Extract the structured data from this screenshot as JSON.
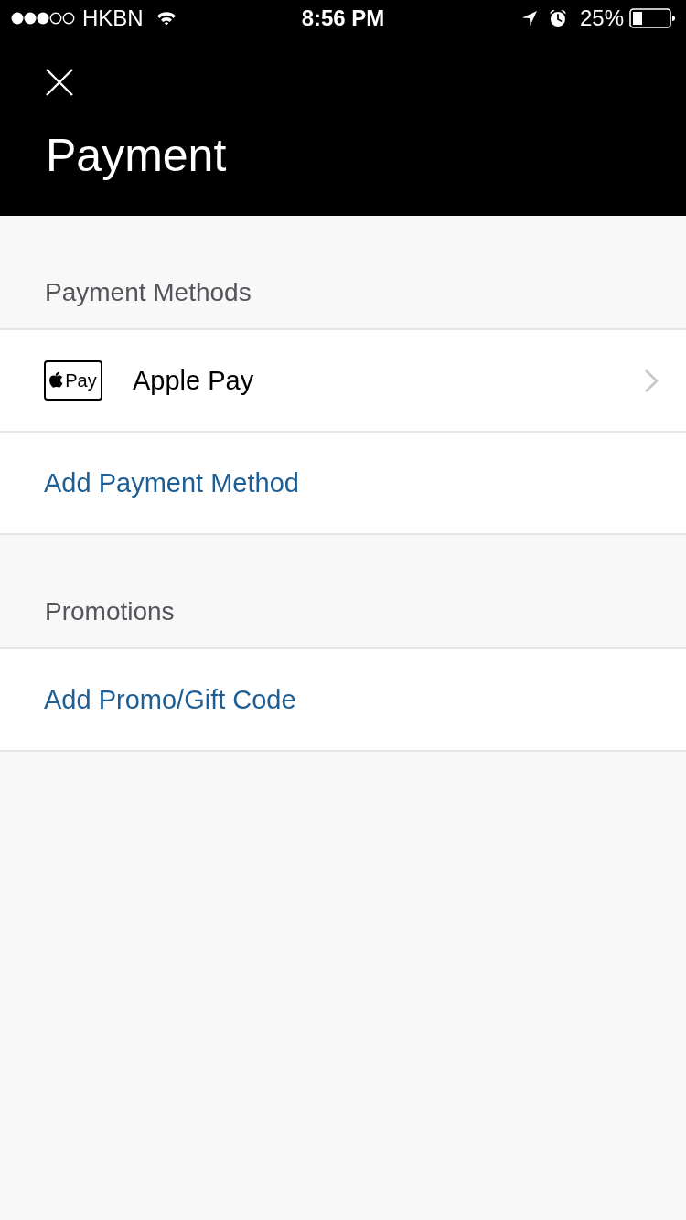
{
  "status_bar": {
    "carrier": "HKBN",
    "time": "8:56 PM",
    "battery": "25%"
  },
  "header": {
    "title": "Payment"
  },
  "sections": [
    {
      "title": "Payment Methods",
      "items": [
        {
          "kind": "method",
          "label": "Apple Pay",
          "badge_text": "Pay"
        },
        {
          "kind": "action",
          "label": "Add Payment Method"
        }
      ]
    },
    {
      "title": "Promotions",
      "items": [
        {
          "kind": "action",
          "label": "Add Promo/Gift Code"
        }
      ]
    }
  ]
}
